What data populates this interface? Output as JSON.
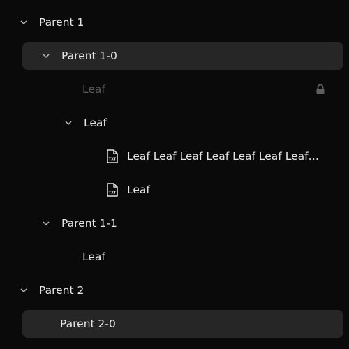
{
  "tree": {
    "parent1": {
      "label": "Parent 1"
    },
    "parent1_0": {
      "label": "Parent 1-0"
    },
    "leaf_disabled": {
      "label": "Leaf"
    },
    "leaf_branch": {
      "label": "Leaf"
    },
    "leaf_long": {
      "label": "Leaf Leaf Leaf Leaf Leaf Leaf Leaf Leaf Leaf Leaf"
    },
    "leaf_file": {
      "label": "Leaf"
    },
    "parent1_1": {
      "label": "Parent 1-1"
    },
    "leaf_child": {
      "label": "Leaf"
    },
    "parent2": {
      "label": "Parent 2"
    },
    "parent2_0": {
      "label": "Parent 2-0"
    }
  },
  "icons": {
    "expand": "chevron-down-icon",
    "file": "txt-file-icon",
    "lock": "lock-icon"
  },
  "colors": {
    "background": "#0a0a0a",
    "selected_row": "#262626",
    "text": "#e6e6e6",
    "disabled_text": "#5a5a5a"
  }
}
